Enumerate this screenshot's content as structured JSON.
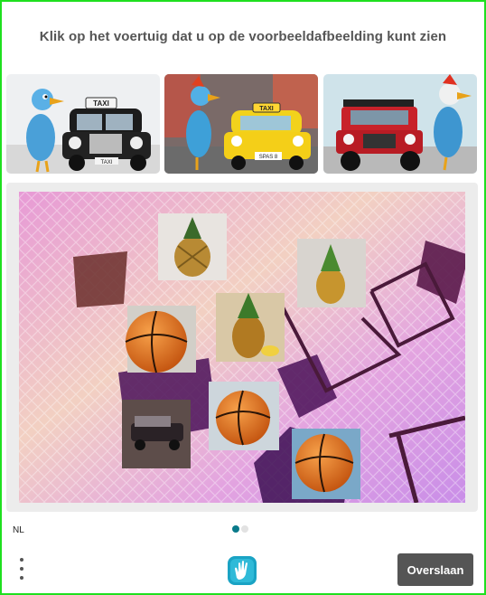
{
  "challenge": {
    "title": "Klik op het voertuig dat u op de voorbeeldafbeelding kunt zien",
    "examples": [
      {
        "plate": "TAXI",
        "sign": "TAXI",
        "vehicle": "black taxi"
      },
      {
        "plate": "SPAS 8",
        "sign": "TAXI",
        "vehicle": "yellow taxi"
      },
      {
        "plate": "",
        "sign": "",
        "vehicle": "red jeep"
      }
    ],
    "tiles": [
      {
        "name": "pineapple"
      },
      {
        "name": "pineapple"
      },
      {
        "name": "pineapple"
      },
      {
        "name": "basketball"
      },
      {
        "name": "basketball"
      },
      {
        "name": "basketball"
      },
      {
        "name": "vehicle"
      }
    ]
  },
  "footer": {
    "language": "NL",
    "skip_label": "Overslaan",
    "pager_total": 2,
    "pager_active": 1
  },
  "colors": {
    "border": "#1fe01f",
    "button": "#555555",
    "pager_active": "#0a7a8a",
    "logo": "#1aa3c4"
  },
  "icons": {
    "menu": "more-vertical-icon",
    "logo": "hand-logo-icon"
  }
}
